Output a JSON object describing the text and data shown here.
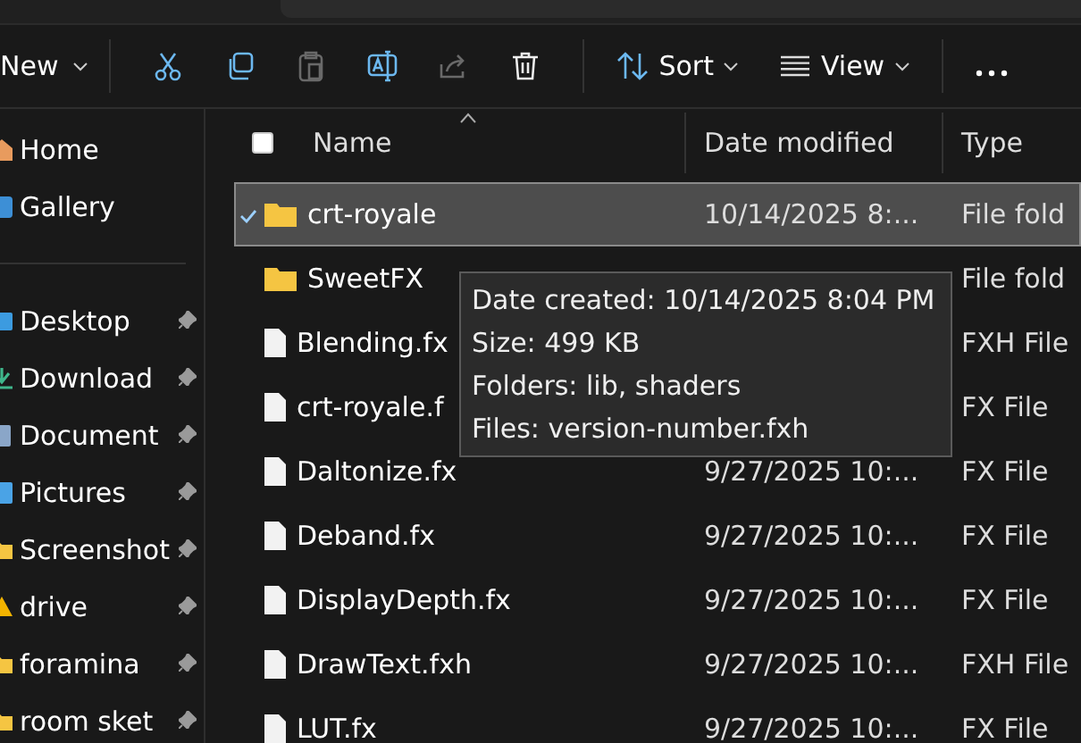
{
  "toolbar": {
    "new_label": "New",
    "actions": [
      {
        "kind": "cut",
        "disabled": false
      },
      {
        "kind": "copy",
        "disabled": false
      },
      {
        "kind": "paste",
        "disabled": true
      },
      {
        "kind": "rename",
        "disabled": false
      },
      {
        "kind": "share",
        "disabled": true
      },
      {
        "kind": "delete",
        "disabled": false
      }
    ],
    "sort_label": "Sort",
    "view_label": "View"
  },
  "sidebar": {
    "groups": [
      [
        {
          "label": "Home",
          "kind": "home",
          "pinned": false
        },
        {
          "label": "Gallery",
          "kind": "gallery",
          "pinned": false
        }
      ],
      [
        {
          "label": "Desktop",
          "kind": "desktop",
          "pinned": true
        },
        {
          "label": "Download",
          "kind": "downloads",
          "pinned": true
        },
        {
          "label": "Document",
          "kind": "documents",
          "pinned": true
        },
        {
          "label": "Pictures",
          "kind": "pictures",
          "pinned": true
        },
        {
          "label": "Screenshot",
          "kind": "folder",
          "pinned": true
        },
        {
          "label": "drive",
          "kind": "drive",
          "pinned": true
        },
        {
          "label": "foramina",
          "kind": "folder",
          "pinned": true
        },
        {
          "label": "room sket",
          "kind": "folder",
          "pinned": true
        }
      ]
    ]
  },
  "list": {
    "all_checked": false,
    "columns": [
      "Name",
      "Date modified",
      "Type"
    ],
    "rows": [
      {
        "name": "crt-royale",
        "kind": "folder",
        "date": "10/14/2025 8:...",
        "type": "File fold",
        "selected": true
      },
      {
        "name": "SweetFX",
        "kind": "folder",
        "type": "File fold",
        "selected": false
      },
      {
        "name": "Blending.fx",
        "kind": "file",
        "type": "FXH File",
        "selected": false
      },
      {
        "name": "crt-royale.f",
        "kind": "file",
        "type": "FX File",
        "selected": false
      },
      {
        "name": "Daltonize.fx",
        "kind": "file",
        "date": "9/27/2025 10:...",
        "type": "FX File",
        "selected": false
      },
      {
        "name": "Deband.fx",
        "kind": "file",
        "date": "9/27/2025 10:...",
        "type": "FX File",
        "selected": false
      },
      {
        "name": "DisplayDepth.fx",
        "kind": "file",
        "date": "9/27/2025 10:...",
        "type": "FX File",
        "selected": false
      },
      {
        "name": "DrawText.fxh",
        "kind": "file",
        "date": "9/27/2025 10:...",
        "type": "FXH File",
        "selected": false
      },
      {
        "name": "LUT.fx",
        "kind": "file",
        "date": "9/27/2025 10:...",
        "type": "FX File",
        "selected": false
      }
    ]
  },
  "tooltip": {
    "lines": [
      "Date created: 10/14/2025 8:04 PM",
      "Size: 499 KB",
      "Folders: lib, shaders",
      "Files: version-number.fxh"
    ]
  }
}
